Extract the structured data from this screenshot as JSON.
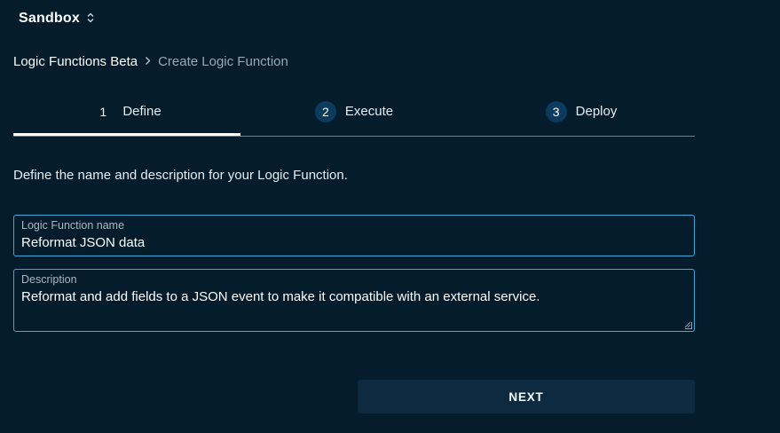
{
  "workspace": {
    "name": "Sandbox",
    "switch_icon": "⌃⌄"
  },
  "breadcrumb": {
    "root": "Logic Functions Beta",
    "separator": "›",
    "current": "Create Logic Function"
  },
  "stepper": {
    "steps": [
      {
        "number": "1",
        "label": "Define",
        "active": true
      },
      {
        "number": "2",
        "label": "Execute",
        "active": false
      },
      {
        "number": "3",
        "label": "Deploy",
        "active": false
      }
    ]
  },
  "instructions": "Define the name and description for your Logic Function.",
  "form": {
    "name": {
      "label": "Logic Function name",
      "value": "Reformat JSON data"
    },
    "description": {
      "label": "Description",
      "value": "Reformat and add fields to a JSON event to make it compatible with an external service."
    }
  },
  "actions": {
    "next_label": "NEXT"
  },
  "colors": {
    "background": "#041c2c",
    "accent": "#2a95c8",
    "step_circle": "#0c3b5e",
    "button_bg": "#0d2a40"
  }
}
